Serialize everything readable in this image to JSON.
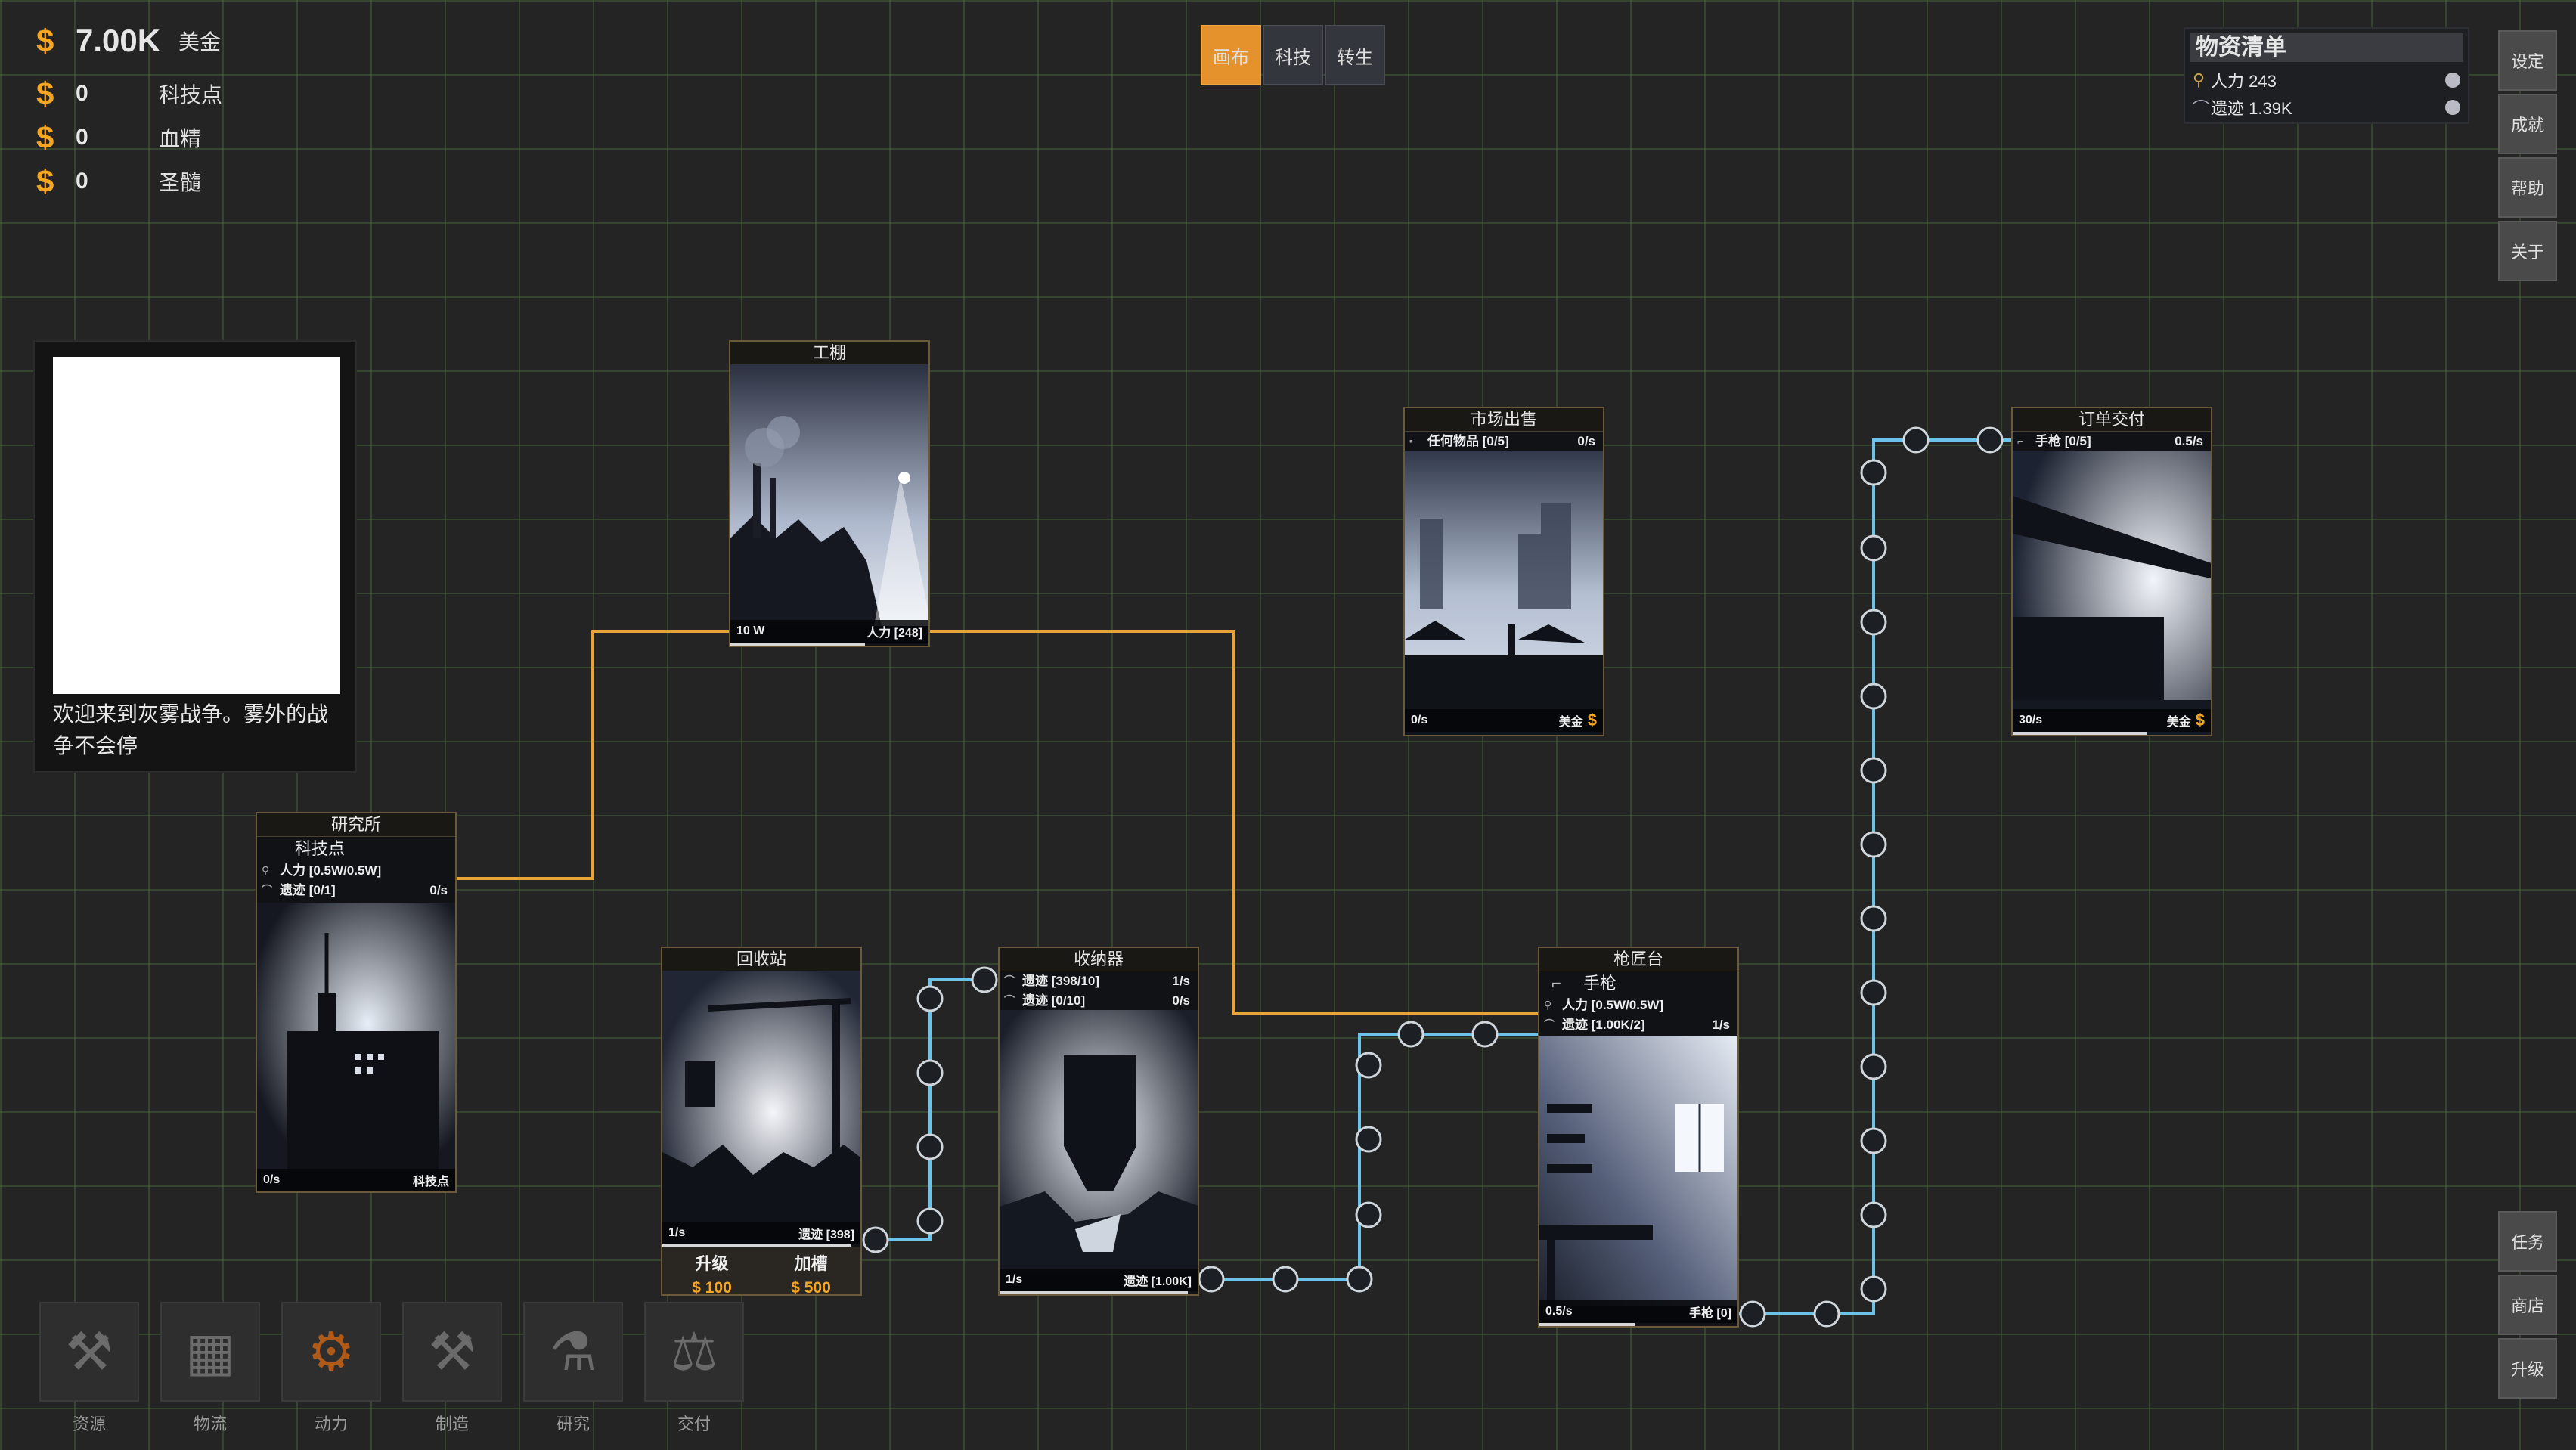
{
  "currencies": [
    {
      "icon": "$",
      "value": "7.00K",
      "name": "美金"
    },
    {
      "icon": "$",
      "value": "0",
      "name": "科技点"
    },
    {
      "icon": "$",
      "value": "0",
      "name": "血精"
    },
    {
      "icon": "$",
      "value": "0",
      "name": "圣髓"
    }
  ],
  "tabs": [
    {
      "label": "画布",
      "active": true
    },
    {
      "label": "科技",
      "active": false
    },
    {
      "label": "转生",
      "active": false
    }
  ],
  "inventory": {
    "title": "物资清单",
    "items": [
      {
        "icon": "manpower-icon",
        "label": "人力 243"
      },
      {
        "icon": "remains-icon",
        "label": "遗迹 1.39K"
      }
    ]
  },
  "side_top": [
    "设定",
    "成就",
    "帮助",
    "关于"
  ],
  "side_bottom": [
    "任务",
    "商店",
    "升级"
  ],
  "welcome": {
    "text": "欢迎来到灰雾战争。雾外的战争不会停"
  },
  "cards": {
    "shed": {
      "title": "工棚",
      "foot_left": "10 W",
      "foot_right": "人力 [248]",
      "progress": 0.68
    },
    "research": {
      "title": "研究所",
      "subtitle": "科技点",
      "slot1": "人力 [0.5W/0.5W]",
      "slot2": "遗迹 [0/1]",
      "slot2_rate": "0/s",
      "foot_left": "0/s",
      "foot_right": "科技点"
    },
    "recycle": {
      "title": "回收站",
      "foot_left": "1/s",
      "foot_right": "遗迹 [398]",
      "upgrade_label": "升级",
      "upgrade_cost": "$ 100",
      "slot_label": "加槽",
      "slot_cost": "$ 500",
      "progress": 0.95
    },
    "storage": {
      "title": "收纳器",
      "slot1": "遗迹 [398/10]",
      "slot1_rate": "1/s",
      "slot2": "遗迹 [0/10]",
      "slot2_rate": "0/s",
      "foot_left": "1/s",
      "foot_right": "遗迹 [1.00K]",
      "progress": 0.95
    },
    "market": {
      "title": "市场出售",
      "slot1": "任何物品 [0/5]",
      "slot1_rate": "0/s",
      "foot_left": "0/s",
      "foot_right": "美金"
    },
    "order": {
      "title": "订单交付",
      "slot1": "手枪 [0/5]",
      "slot1_rate": "0.5/s",
      "foot_left": "30/s",
      "foot_right": "美金",
      "progress": 0.68
    },
    "gunsmith": {
      "title": "枪匠台",
      "subtitle": "手枪",
      "slot1": "人力 [0.5W/0.5W]",
      "slot2": "遗迹 [1.00K/2]",
      "slot2_rate": "1/s",
      "foot_left": "0.5/s",
      "foot_right": "手枪 [0]",
      "progress": 0.48
    }
  },
  "toolbar": [
    {
      "label": "资源",
      "icon": "pickaxe-hammer-icon"
    },
    {
      "label": "物流",
      "icon": "crate-icon"
    },
    {
      "label": "动力",
      "icon": "power-gear-icon"
    },
    {
      "label": "制造",
      "icon": "wrench-hammer-icon"
    },
    {
      "label": "研究",
      "icon": "flask-icon"
    },
    {
      "label": "交付",
      "icon": "scale-icon"
    }
  ],
  "colors": {
    "accent": "#e6922c",
    "power_wire": "#e8a33a",
    "item_wire": "#6cc3ea",
    "currency": "#f5a623"
  }
}
